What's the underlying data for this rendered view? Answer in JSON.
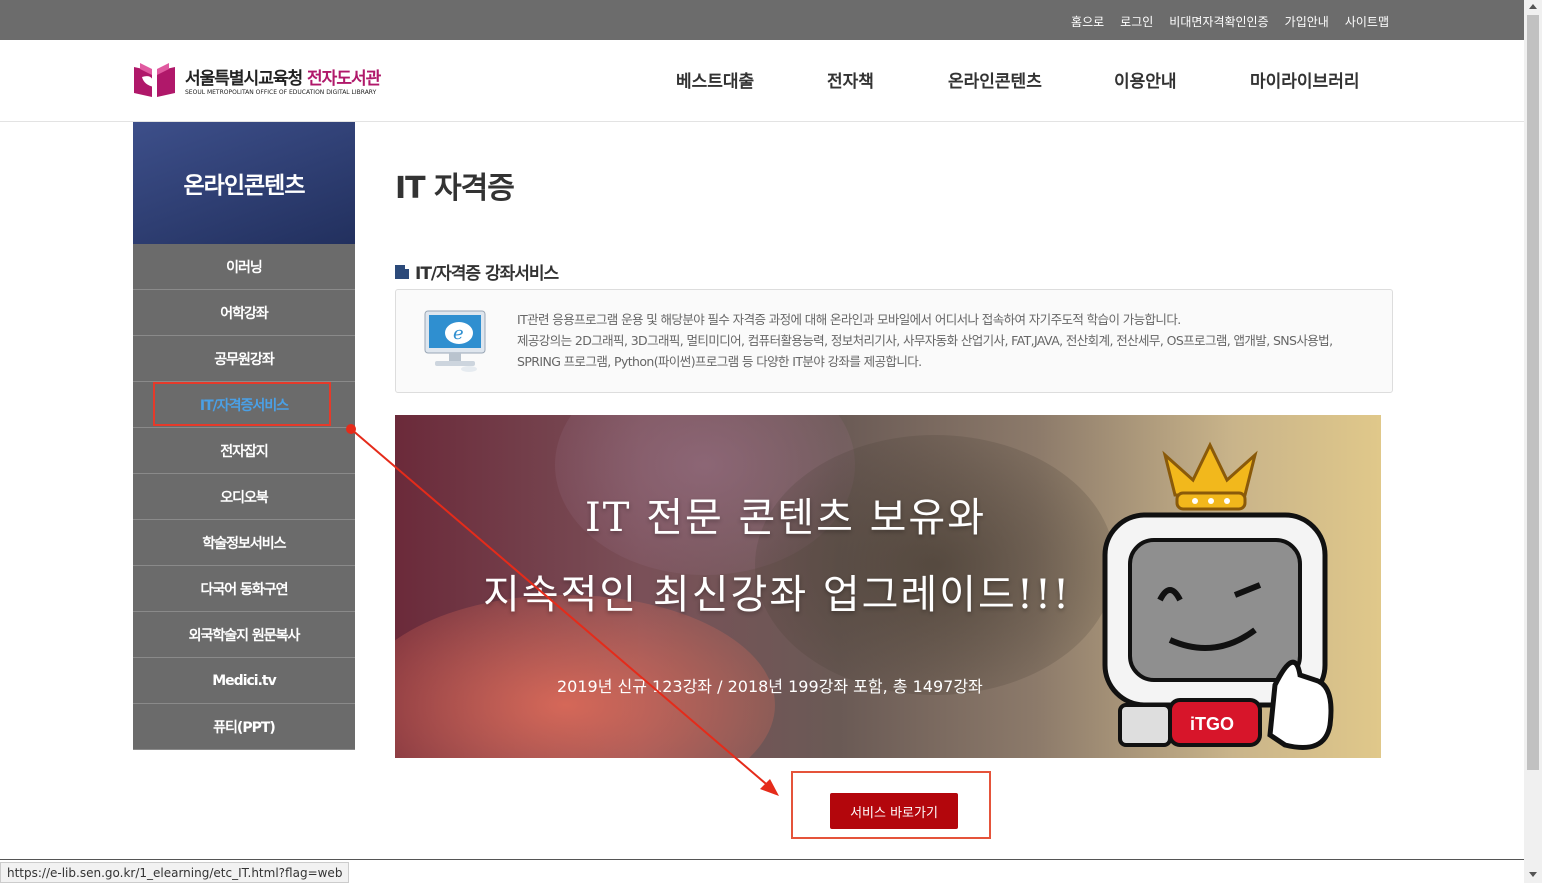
{
  "utility_links": [
    "홈으로",
    "로그인",
    "비대면자격확인인증",
    "가입안내",
    "사이트맵"
  ],
  "logo": {
    "title_main": "서울특별시교육청 ",
    "title_accent": "전자도서관",
    "subtitle": "SEOUL METROPOLITAN OFFICE OF EDUCATION DIGITAL LIBRARY"
  },
  "gnb": [
    "베스트대출",
    "전자책",
    "온라인콘텐츠",
    "이용안내",
    "마이라이브러리"
  ],
  "sidebar": {
    "title": "온라인콘텐츠",
    "items": [
      "이러닝",
      "어학강좌",
      "공무원강좌",
      "IT/자격증서비스",
      "전자잡지",
      "오디오북",
      "학술정보서비스",
      "다국어 동화구연",
      "외국학술지 원문복사",
      "Medici.tv",
      "퓨티(PPT)"
    ],
    "active_index": 3
  },
  "main": {
    "page_title": "IT 자격증",
    "section_title": "IT/자격증 강좌서비스",
    "desc_line1": "IT관련 응용프로그램 운용 및 해당분야 필수 자격증 과정에 대해 온라인과 모바일에서 어디서나 접속하여 자기주도적 학습이 가능합니다.",
    "desc_line2": "제공강의는 2D그래픽, 3D그래픽, 멀티미디어, 컴퓨터활용능력, 정보처리기사, 사무자동화 산업기사, FAT,JAVA, 전산회계, 전산세무, OS프로그램, 앱개발, SNS사용법, SPRING 프로그램, Python(파이썬)프로그램 등 다양한 IT분야 강좌를 제공합니다.",
    "banner_line1": "IT 전문 콘텐츠 보유와",
    "banner_line2": "지속적인 최신강좌 업그레이드!!!",
    "banner_sub": "2019년 신규 123강좌 / 2018년 199강좌 포함, 총 1497강좌",
    "mascot_badge": "iTGO",
    "service_button": "서비스 바로가기"
  },
  "status_bar_url": "https://e-lib.sen.go.kr/1_elearning/etc_IT.html?flag=web",
  "colors": {
    "utility_bar": "#6c6c6c",
    "sidebar_head": "#2c3b6e",
    "sidebar_item": "#6b6b6b",
    "active_text": "#4aa0e6",
    "button": "#b3060c",
    "annotation": "#e53a2a"
  }
}
